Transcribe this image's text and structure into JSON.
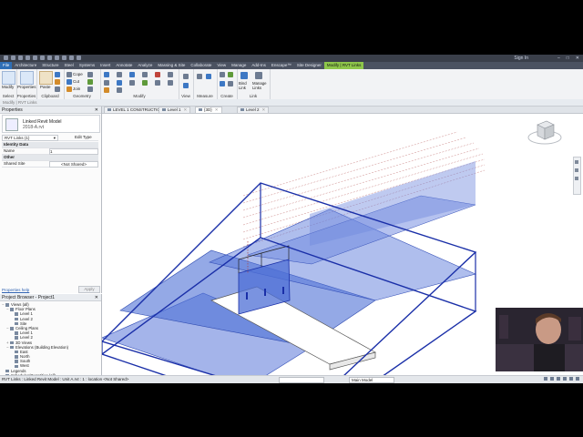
{
  "titlebar": {
    "sign_in": "Sign In",
    "window_controls": [
      "–",
      "□",
      "✕"
    ]
  },
  "ribbon_tabs": [
    "File",
    "Architecture",
    "Structure",
    "Steel",
    "Systems",
    "Insert",
    "Annotate",
    "Analyze",
    "Massing & Site",
    "Collaborate",
    "View",
    "Manage",
    "Add-Ins",
    "Enscape™",
    "Site Designer",
    "Modify | RVT Links"
  ],
  "ribbon_groups": {
    "select": "Select",
    "properties": "Properties",
    "clipboard": "Clipboard",
    "geometry": "Geometry",
    "modify": "Modify",
    "view": "View",
    "measure": "Measure",
    "create": "Create",
    "link": "Link"
  },
  "ribbon_buttons": {
    "modify": "Modify",
    "properties": "Properties",
    "paste": "Paste",
    "cope": "Cope",
    "cut": "Cut",
    "join": "Join",
    "bind_link": "Bind Link",
    "manage_links": "Manage Links"
  },
  "options_bar": "Modify | RVT Links",
  "properties": {
    "header": "Properties",
    "close": "✕",
    "type_line1": "Linked Revit Model",
    "type_line2": "2018-A.rvt",
    "selector": "RVT Links (1)",
    "edit_type": "Edit Type",
    "section_identity": "Identity Data",
    "name_key": "Name",
    "name_value": "1",
    "section_other": "Other",
    "shared_site_key": "Shared Site",
    "shared_site_value": "<Not Shared>",
    "help_link": "Properties help",
    "apply": "Apply"
  },
  "project_browser": {
    "header": "Project Browser - Project1",
    "close": "✕",
    "tree": [
      {
        "label": "Views (all)",
        "level": 0,
        "toggle": "−"
      },
      {
        "label": "Floor Plans",
        "level": 1,
        "toggle": "−"
      },
      {
        "label": "Level 1",
        "level": 2,
        "toggle": ""
      },
      {
        "label": "Level 2",
        "level": 2,
        "toggle": ""
      },
      {
        "label": "Site",
        "level": 2,
        "toggle": ""
      },
      {
        "label": "Ceiling Plans",
        "level": 1,
        "toggle": "−"
      },
      {
        "label": "Level 1",
        "level": 2,
        "toggle": ""
      },
      {
        "label": "Level 2",
        "level": 2,
        "toggle": ""
      },
      {
        "label": "3D Views",
        "level": 1,
        "toggle": "+"
      },
      {
        "label": "Elevations (Building Elevation)",
        "level": 1,
        "toggle": "−"
      },
      {
        "label": "East",
        "level": 2,
        "toggle": ""
      },
      {
        "label": "North",
        "level": 2,
        "toggle": ""
      },
      {
        "label": "South",
        "level": 2,
        "toggle": ""
      },
      {
        "label": "West",
        "level": 2,
        "toggle": ""
      },
      {
        "label": "Legends",
        "level": 0,
        "toggle": ""
      },
      {
        "label": "Schedules/Quantities (all)",
        "level": 0,
        "toggle": ""
      },
      {
        "label": "Sheets (all)",
        "level": 0,
        "toggle": ""
      },
      {
        "label": "Families",
        "level": 0,
        "toggle": "+"
      },
      {
        "label": "Groups",
        "level": 0,
        "toggle": "−"
      },
      {
        "label": "Detail",
        "level": 1,
        "toggle": ""
      },
      {
        "label": "Model",
        "level": 1,
        "toggle": ""
      },
      {
        "label": "Revit Links",
        "level": 0,
        "toggle": "+"
      }
    ]
  },
  "view_tabs": [
    {
      "label": "LEVEL 1 CONSTRUCTION",
      "active": false
    },
    {
      "label": "Level 1",
      "active": false
    },
    {
      "label": "{3D}",
      "active": true
    },
    {
      "label": "Level 2",
      "active": false
    }
  ],
  "view_tab_close": "✕",
  "view_bar": {
    "scale": "1/8\" = 1'-0\""
  },
  "status_bar": {
    "text": "RVT Links : Linked Revit Model : Unit A.rvt : 1 : location <Not Shared>",
    "main_model": "Main Model"
  },
  "nav_cube": {
    "face": "FRONT"
  },
  "colors": {
    "accent_tab": "#8ec64a",
    "file_tab": "#2f6fb6",
    "link_outline": "#1a2fa8",
    "link_fill": "#4d6fd6"
  }
}
